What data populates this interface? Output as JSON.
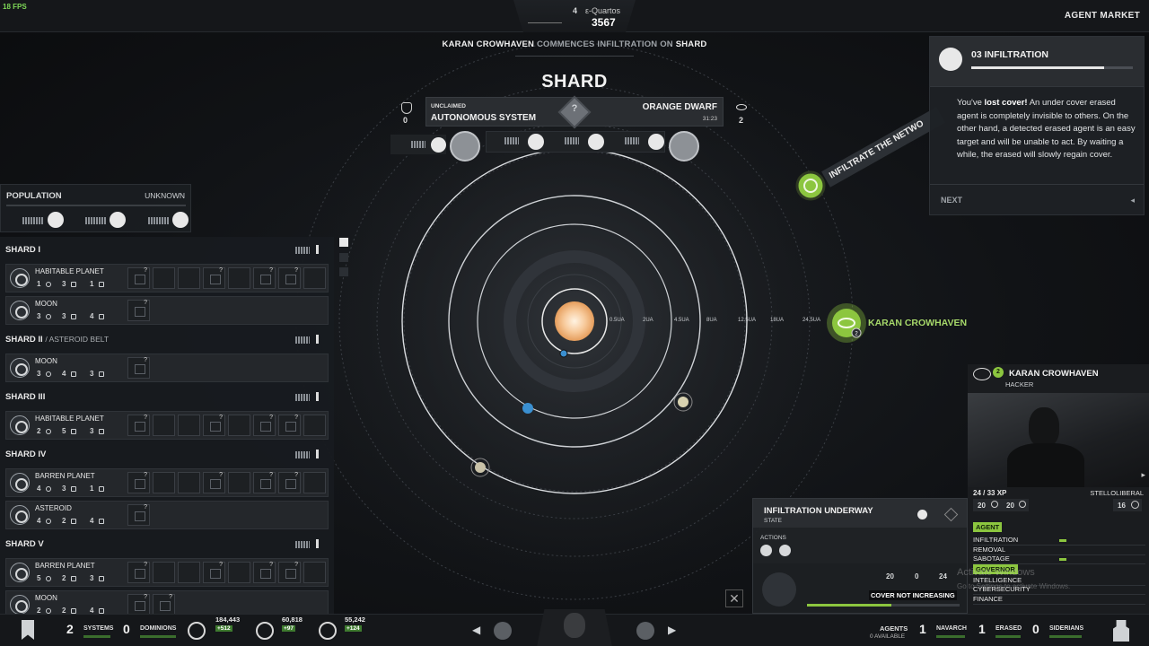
{
  "hud": {
    "fps": "18 FPS",
    "agent_market": "AGENT MARKET"
  },
  "currency": {
    "quartos_count": "4",
    "quartos_label": "ε-Quartos",
    "quartos_total": "3567"
  },
  "event": {
    "agent": "KARAN CROWHAVEN",
    "verb": "COMMENCES INFILTRATION ON",
    "target": "SHARD"
  },
  "system": {
    "name": "SHARD",
    "claim_status": "UNCLAIMED",
    "government": "AUTONOMOUS SYSTEM",
    "star_type": "ORANGE DWARF",
    "time": "31:23",
    "left_count": "0",
    "watchers": "2",
    "unknown_mark": "?"
  },
  "orbit_labels": [
    "0.5UA",
    "2UA",
    "4.5UA",
    "8UA",
    "12.5UA",
    "18UA",
    "24.5UA"
  ],
  "infiltrate_label": "INFILTRATE THE NETWO",
  "map_agent_name": "KARAN CROWHAVEN",
  "map_agent_badge": "2",
  "population": {
    "title": "POPULATION",
    "status": "UNKNOWN"
  },
  "shards": [
    {
      "title": "SHARD I",
      "sub": "",
      "bodies": [
        {
          "type": "HABITABLE PLANET",
          "stats": [
            "1",
            "3",
            "1"
          ]
        },
        {
          "type": "MOON",
          "stats": [
            "3",
            "3",
            "4"
          ]
        }
      ]
    },
    {
      "title": "SHARD II",
      "sub": "/ ASTEROID BELT",
      "bodies": [
        {
          "type": "MOON",
          "stats": [
            "3",
            "4",
            "3"
          ]
        }
      ]
    },
    {
      "title": "SHARD III",
      "sub": "",
      "bodies": [
        {
          "type": "HABITABLE PLANET",
          "stats": [
            "2",
            "5",
            "3"
          ]
        }
      ]
    },
    {
      "title": "SHARD IV",
      "sub": "",
      "bodies": [
        {
          "type": "BARREN PLANET",
          "stats": [
            "4",
            "3",
            "1"
          ]
        },
        {
          "type": "ASTEROID",
          "stats": [
            "4",
            "2",
            "4"
          ]
        }
      ]
    },
    {
      "title": "SHARD V",
      "sub": "",
      "bodies": [
        {
          "type": "BARREN PLANET",
          "stats": [
            "5",
            "2",
            "3"
          ]
        },
        {
          "type": "MOON",
          "stats": [
            "2",
            "2",
            "4"
          ]
        }
      ]
    }
  ],
  "cell_q": "?",
  "tutorial": {
    "title": "03 INFILTRATION",
    "lead": "You've ",
    "lead_bold": "lost cover!",
    "body": " An under cover erased agent is completely invisible to others. On the other hand, a detected erased agent is an easy target and will be unable to act. By waiting a while, the erased will slowly regain cover.",
    "next": "NEXT",
    "progress": 0.82
  },
  "agent": {
    "name": "KARAN CROWHAVEN",
    "role": "HACKER",
    "badge": "2",
    "xp": "24 / 33",
    "xp_label": "XP",
    "faction": "STELLOLIBERAL",
    "val_a": "20",
    "val_b": "20",
    "val_c": "16",
    "agent_tag": "AGENT",
    "governor_tag": "GOVERNOR",
    "skills_agent": [
      {
        "name": "INFILTRATION",
        "level": 0.08
      },
      {
        "name": "REMOVAL",
        "level": 0
      },
      {
        "name": "SABOTAGE",
        "level": 0.08
      }
    ],
    "skills_governor": [
      {
        "name": "INTELLIGENCE",
        "level": 0
      },
      {
        "name": "CYBERSECURITY",
        "level": 0
      },
      {
        "name": "FINANCE",
        "level": 0
      }
    ]
  },
  "infiltration": {
    "title": "INFILTRATION UNDERWAY",
    "state": "STATE",
    "actions": "ACTIONS",
    "n1": "20",
    "n2": "0",
    "n3": "24",
    "cover": "COVER NOT INCREASING",
    "cover_level": 0.55
  },
  "watermark": {
    "line1": "Activate Windows",
    "line2": "Go to Settings to activate Windows."
  },
  "bottom": {
    "systems_count": "2",
    "systems_label": "SYSTEMS",
    "dominions_count": "0",
    "dominions_label": "DOMINIONS",
    "res1": "184,443",
    "res1_delta": "+512",
    "res2": "60,818",
    "res2_delta": "+97",
    "res3": "55,242",
    "res3_delta": "+124",
    "agents_label": "AGENTS",
    "agents_sub": "0 AVAILABLE",
    "navarch_count": "1",
    "navarch_label": "NAVARCH",
    "erased_count": "1",
    "erased_label": "ERASED",
    "siderians_count": "0",
    "siderians_label": "SIDERIANS"
  },
  "colors": {
    "accent_green": "#8cc63f",
    "sun": "#f7c99a",
    "planet_blue": "#3a8fd0"
  }
}
